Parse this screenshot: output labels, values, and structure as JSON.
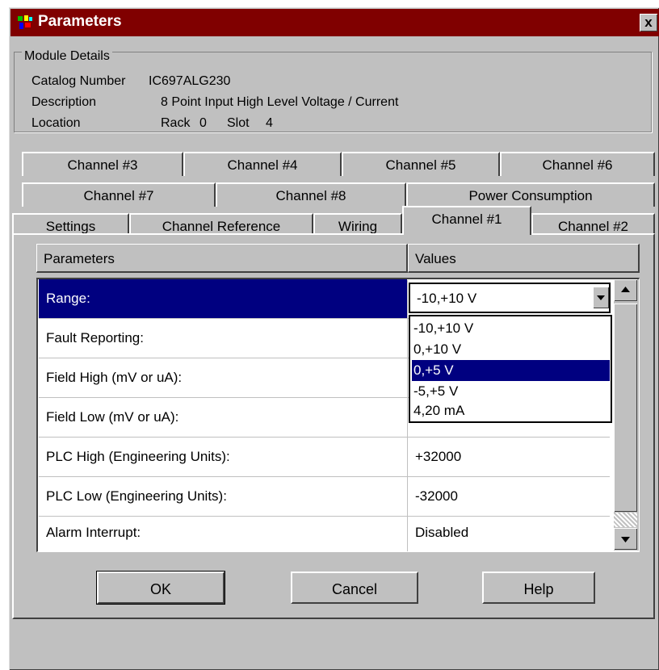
{
  "window": {
    "title": "Parameters",
    "close_label": "x",
    "colors": {
      "titlebar": "#800000",
      "face": "#c0c0c0",
      "selection": "#000080"
    }
  },
  "module_details": {
    "group_label": "Module Details",
    "catalog_label": "Catalog Number",
    "catalog_value": "IC697ALG230",
    "description_label": "Description",
    "description_value": "8 Point Input High Level Voltage / Current",
    "location_label": "Location",
    "rack_label": "Rack",
    "rack_value": "0",
    "slot_label": "Slot",
    "slot_value": "4"
  },
  "tabs": {
    "row1": [
      "Channel #3",
      "Channel #4",
      "Channel #5",
      "Channel #6"
    ],
    "row2": [
      "Channel #7",
      "Channel #8",
      "Power Consumption"
    ],
    "row3": [
      "Settings",
      "Channel Reference",
      "Wiring",
      "Channel #1",
      "Channel #2"
    ],
    "active": "Channel #1"
  },
  "grid": {
    "headers": {
      "parameters": "Parameters",
      "values": "Values"
    },
    "rows": [
      {
        "param": "Range:",
        "value": "-10,+10 V"
      },
      {
        "param": "Fault Reporting:",
        "value": ""
      },
      {
        "param": "Field High (mV or uA):",
        "value": ""
      },
      {
        "param": "Field Low (mV or uA):",
        "value": ""
      },
      {
        "param": "PLC High (Engineering Units):",
        "value": "+32000"
      },
      {
        "param": "PLC Low (Engineering Units):",
        "value": "-32000"
      },
      {
        "param": "Alarm Interrupt:",
        "value": "Disabled"
      }
    ]
  },
  "range_dropdown": {
    "selected": "-10,+10 V",
    "options": [
      "-10,+10 V",
      "0,+10 V",
      "0,+5 V",
      "-5,+5 V",
      "4,20 mA"
    ],
    "highlighted": "0,+5 V"
  },
  "buttons": {
    "ok": "OK",
    "cancel": "Cancel",
    "help": "Help"
  }
}
